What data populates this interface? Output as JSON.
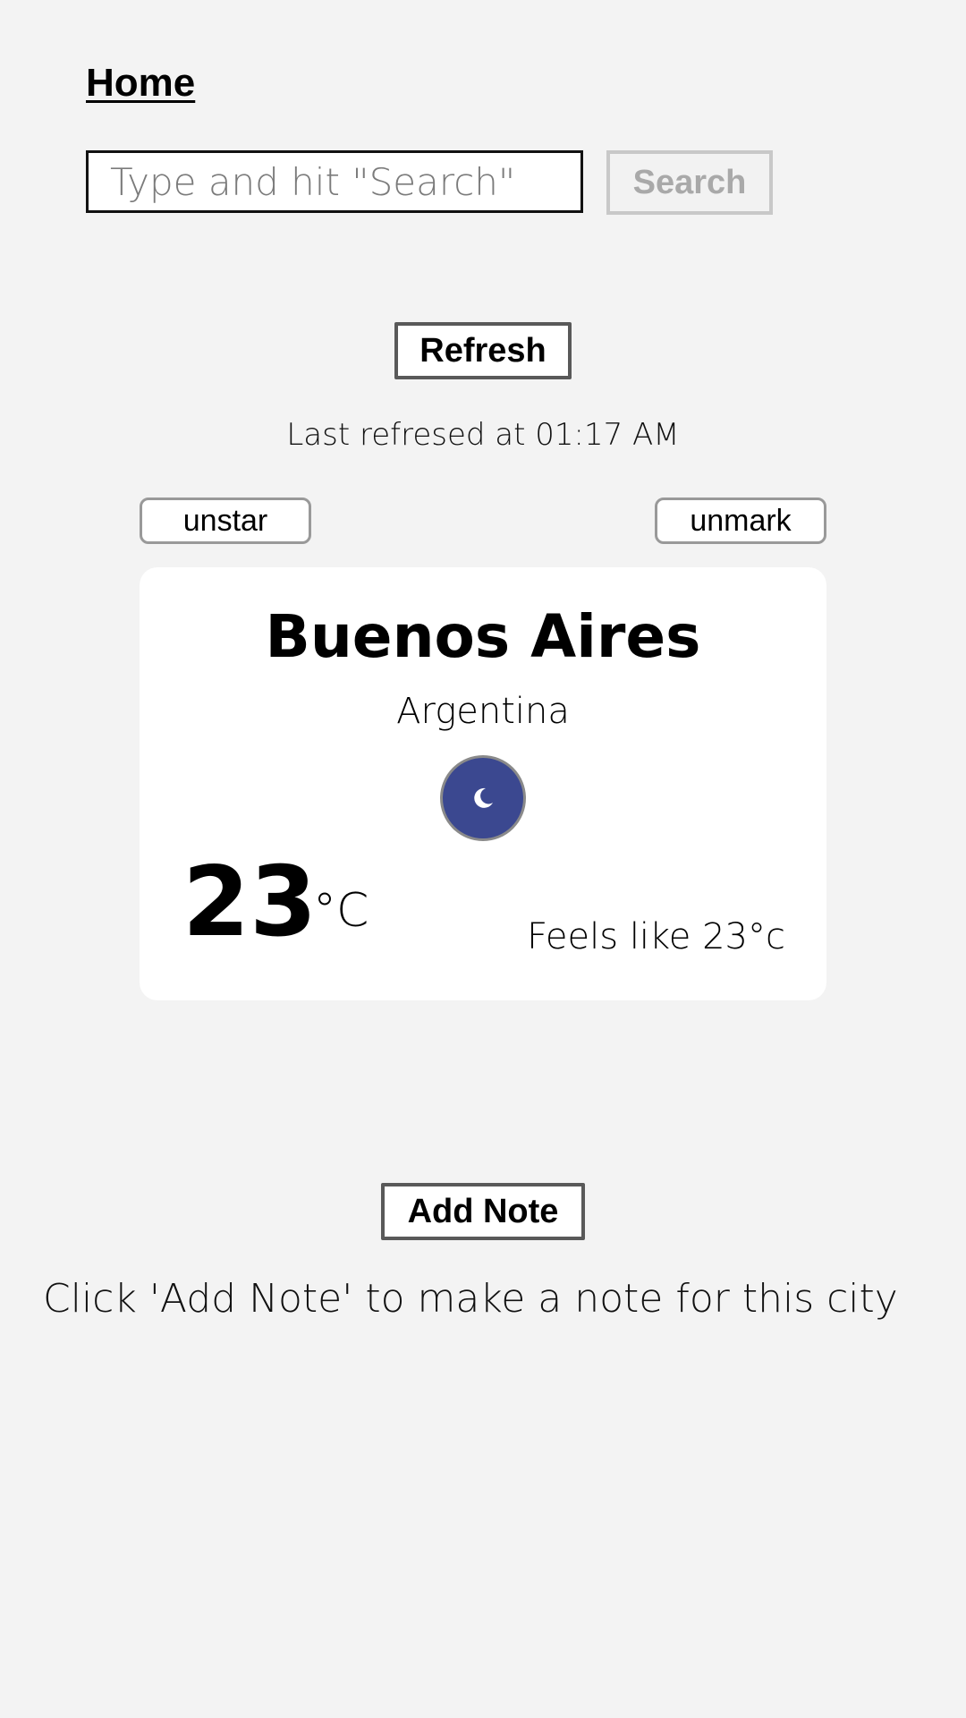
{
  "nav": {
    "home_label": "Home"
  },
  "search": {
    "placeholder": "Type and hit \"Search\"",
    "value": "",
    "button_label": "Search"
  },
  "refresh": {
    "button_label": "Refresh",
    "status_text": "Last refresed at 01:17 AM"
  },
  "actions": {
    "unstar_label": "unstar",
    "unmark_label": "unmark"
  },
  "weather": {
    "city": "Buenos Aires",
    "country": "Argentina",
    "condition_icon": "moon-icon",
    "temperature": "23",
    "unit": "°C",
    "feels_like": "Feels like 23°c",
    "colors": {
      "card_background": "#ffffff",
      "icon_background": "#3b4890"
    }
  },
  "notes": {
    "add_button_label": "Add Note",
    "hint_text": "Click 'Add Note' to make a note for this city"
  },
  "colors": {
    "page_background": "#f3f3f3",
    "disabled_button_text": "#a9a9a9"
  }
}
